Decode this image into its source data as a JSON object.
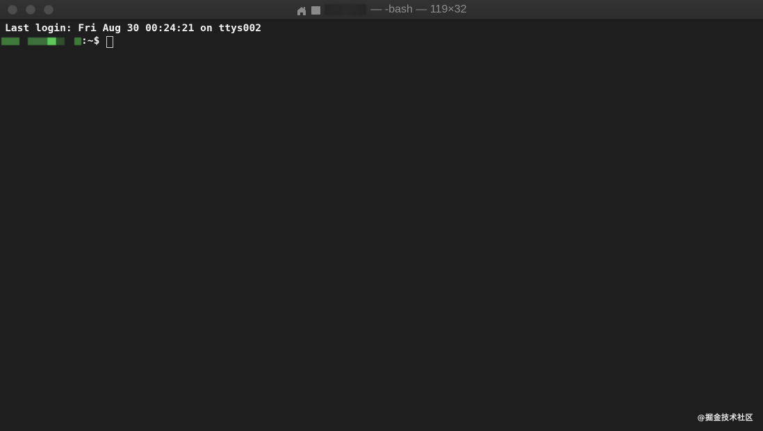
{
  "window": {
    "title": "— -bash — 119×32",
    "icons": [
      "home-icon",
      "terminal-tty-icon"
    ]
  },
  "terminal": {
    "last_login": "Last login: Fri Aug 30 00:24:21 on ttys002",
    "prompt_suffix": ":~$"
  },
  "watermark": "@掘金技术社区",
  "colors": {
    "background": "#1e1e1e",
    "titlebar": "#2e2e2e",
    "text": "#f2f2f2",
    "title_text": "#8d8d8d"
  }
}
